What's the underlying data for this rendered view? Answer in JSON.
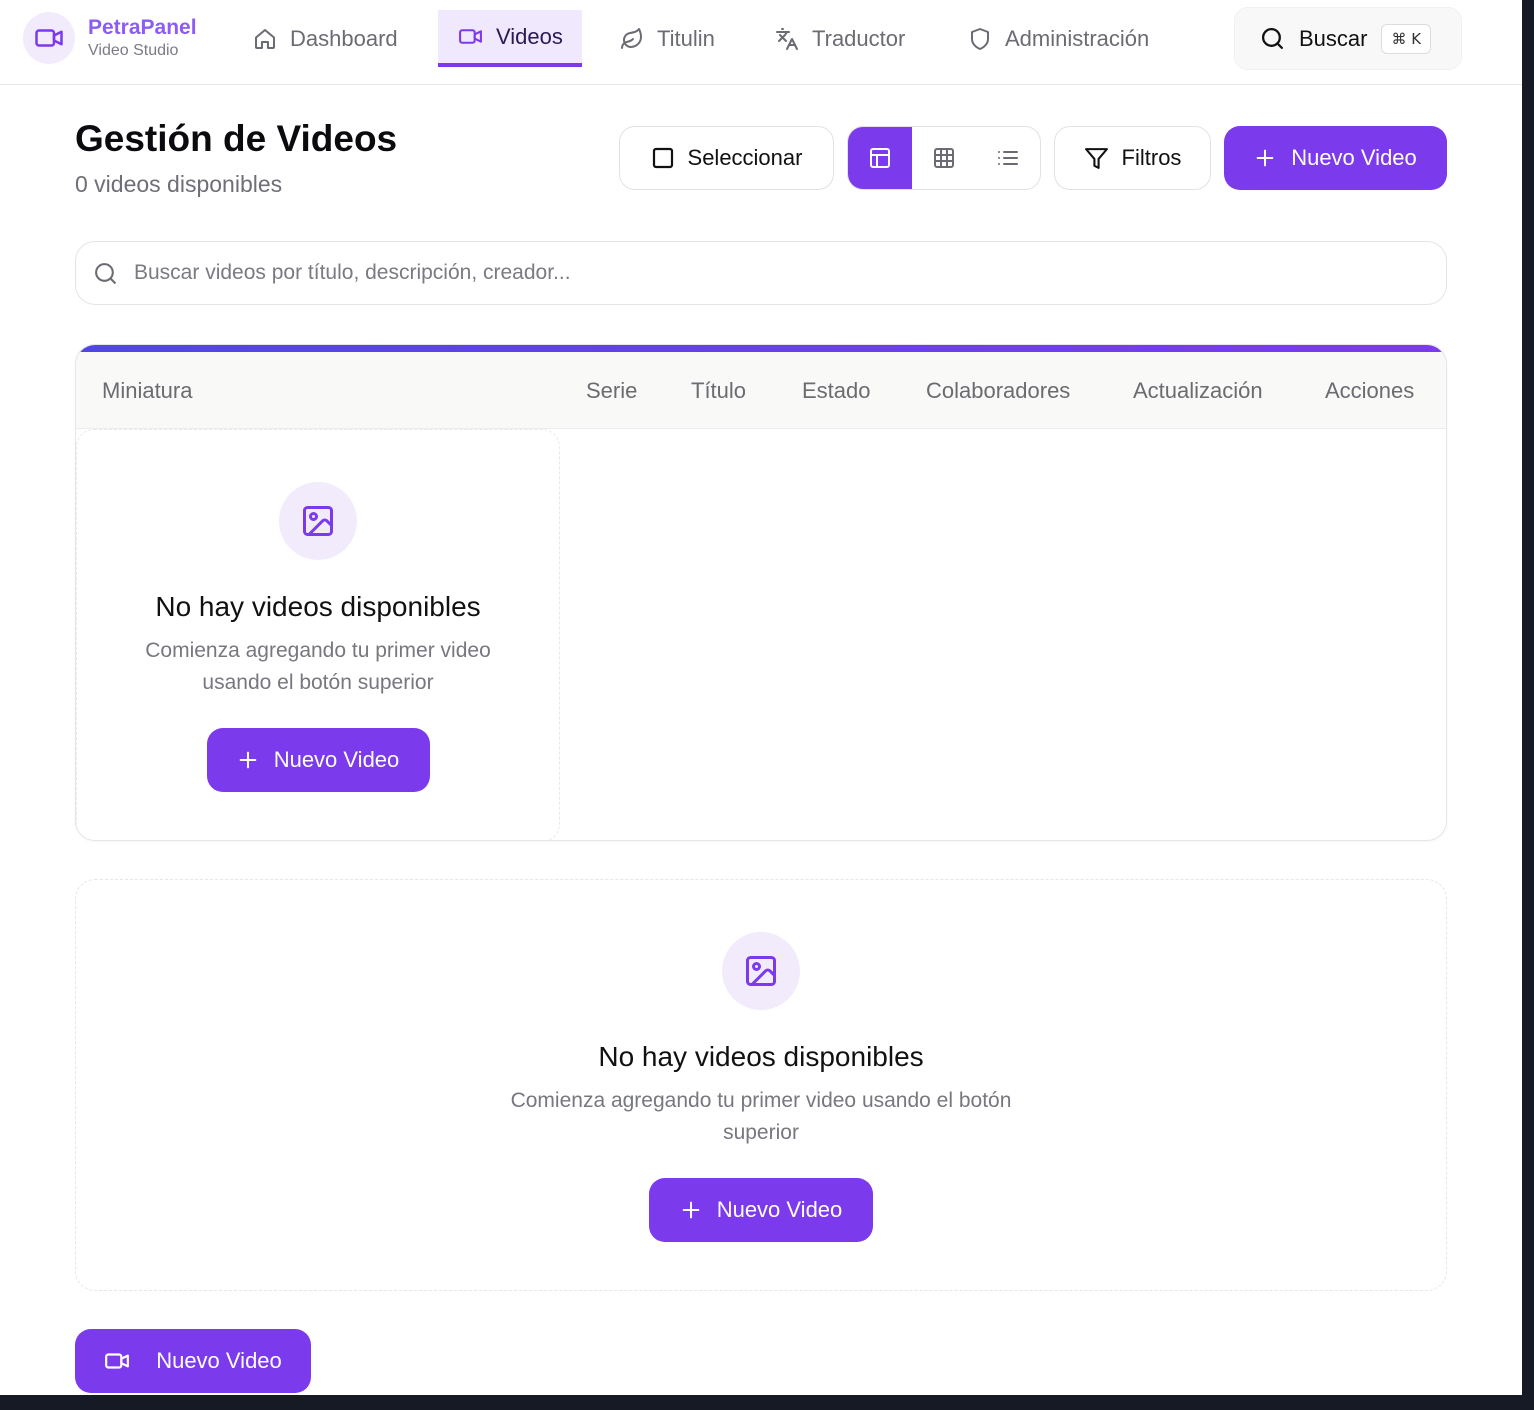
{
  "brand": {
    "name": "PetraPanel",
    "subtitle": "Video Studio"
  },
  "nav": {
    "items": [
      {
        "label": "Dashboard",
        "icon": "home-icon"
      },
      {
        "label": "Videos",
        "icon": "video-camera-icon",
        "active": true
      },
      {
        "label": "Titulin",
        "icon": "leaf-icon"
      },
      {
        "label": "Traductor",
        "icon": "translate-icon"
      },
      {
        "label": "Administración",
        "icon": "shield-icon"
      }
    ],
    "search_label": "Buscar",
    "search_shortcut": "⌘ K"
  },
  "header": {
    "title": "Gestión de Videos",
    "count": "0 videos disponibles",
    "select_label": "Seleccionar",
    "filters_label": "Filtros",
    "new_video_label": "Nuevo Video",
    "view_modes": [
      "table-view",
      "grid-view",
      "list-view"
    ],
    "active_view": "table-view"
  },
  "search": {
    "placeholder": "Buscar videos por título, descripción, creador..."
  },
  "table": {
    "columns": [
      "Miniatura",
      "Serie",
      "Título",
      "Estado",
      "Colaboradores",
      "Actualización",
      "Acciones"
    ],
    "empty": {
      "title": "No hay videos disponibles",
      "text": "Comienza agregando tu primer video usando el botón superior",
      "button": "Nuevo Video"
    }
  },
  "empty_card": {
    "title": "No hay videos disponibles",
    "text": "Comienza agregando tu primer video usando el botón superior",
    "button": "Nuevo Video"
  },
  "fab": {
    "label": "Nuevo Video"
  },
  "colors": {
    "accent": "#7c3aed",
    "accent_soft": "#f1ebfc",
    "brand_text": "#8b5cf6"
  }
}
